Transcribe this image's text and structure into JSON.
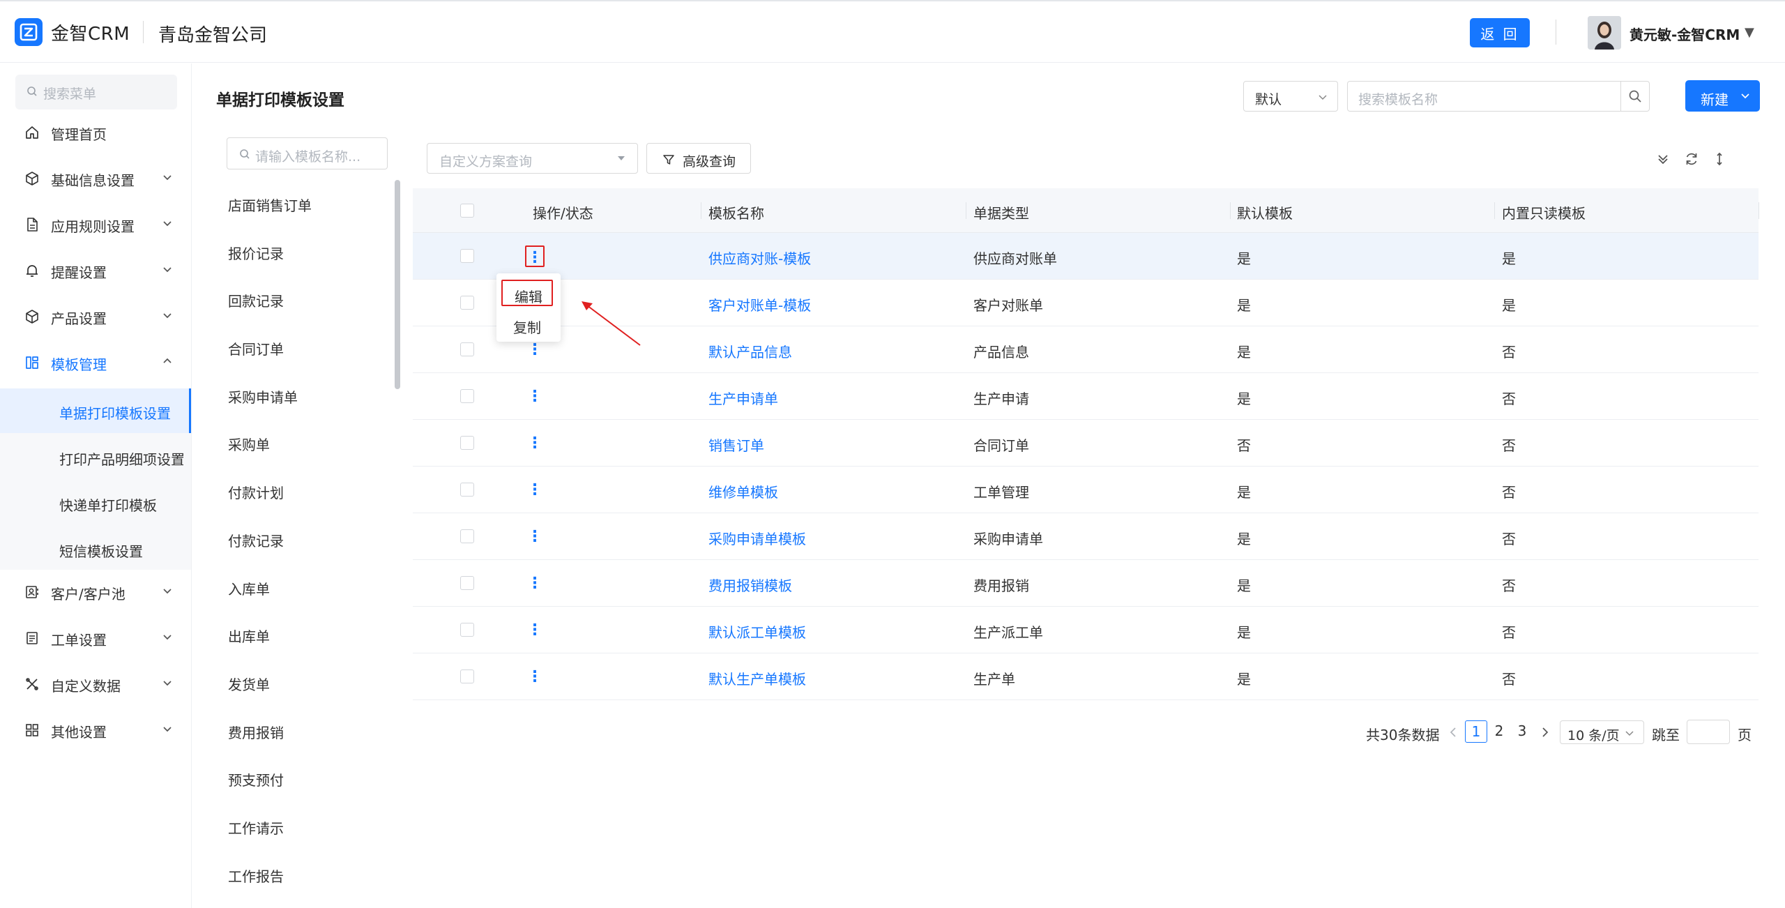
{
  "header": {
    "brand": "金智CRM",
    "company": "青岛金智公司",
    "back_label": "返 回",
    "user_name": "黄元敏-金智CRM"
  },
  "sidebar": {
    "search_placeholder": "搜索菜单",
    "items": [
      {
        "label": "管理首页",
        "icon": "home-icon",
        "arrow": ""
      },
      {
        "label": "基础信息设置",
        "icon": "cube-icon",
        "arrow": "down"
      },
      {
        "label": "应用规则设置",
        "icon": "document-icon",
        "arrow": "down"
      },
      {
        "label": "提醒设置",
        "icon": "bell-icon",
        "arrow": "down"
      },
      {
        "label": "产品设置",
        "icon": "box-icon",
        "arrow": "down"
      },
      {
        "label": "模板管理",
        "icon": "template-icon",
        "arrow": "up"
      },
      {
        "label": "客户/客户池",
        "icon": "contacts-icon",
        "arrow": "down"
      },
      {
        "label": "工单设置",
        "icon": "list-icon",
        "arrow": "down"
      },
      {
        "label": "自定义数据",
        "icon": "tools-icon",
        "arrow": "down"
      },
      {
        "label": "其他设置",
        "icon": "grid-icon",
        "arrow": "down"
      }
    ],
    "sub_items": [
      {
        "label": "单据打印模板设置",
        "active": true
      },
      {
        "label": "打印产品明细项设置",
        "active": false
      },
      {
        "label": "快递单打印模板",
        "active": false
      },
      {
        "label": "短信模板设置",
        "active": false
      }
    ]
  },
  "page": {
    "title": "单据打印模板设置",
    "default_select": "默认",
    "search_placeholder": "搜索模板名称",
    "new_label": "新建"
  },
  "type_list": {
    "search_placeholder": "请输入模板名称...",
    "items": [
      "店面销售订单",
      "报价记录",
      "回款记录",
      "合同订单",
      "采购申请单",
      "采购单",
      "付款计划",
      "付款记录",
      "入库单",
      "出库单",
      "发货单",
      "费用报销",
      "预支预付",
      "工作请示",
      "工作报告"
    ]
  },
  "filter": {
    "scheme_placeholder": "自定义方案查询",
    "advanced_label": "高级查询"
  },
  "table": {
    "columns": [
      "操作/状态",
      "模板名称",
      "单据类型",
      "默认模板",
      "内置只读模板"
    ],
    "rows": [
      {
        "name": "供应商对账-模板",
        "type": "供应商对账单",
        "default": "是",
        "readonly": "是"
      },
      {
        "name": "客户对账单-模板",
        "type": "客户对账单",
        "default": "是",
        "readonly": "是"
      },
      {
        "name": "默认产品信息",
        "type": "产品信息",
        "default": "是",
        "readonly": "否"
      },
      {
        "name": "生产申请单",
        "type": "生产申请",
        "default": "是",
        "readonly": "否"
      },
      {
        "name": "销售订单",
        "type": "合同订单",
        "default": "否",
        "readonly": "否"
      },
      {
        "name": "维修单模板",
        "type": "工单管理",
        "default": "是",
        "readonly": "否"
      },
      {
        "name": "采购申请单模板",
        "type": "采购申请单",
        "default": "是",
        "readonly": "否"
      },
      {
        "name": "费用报销模板",
        "type": "费用报销",
        "default": "是",
        "readonly": "否"
      },
      {
        "name": "默认派工单模板",
        "type": "生产派工单",
        "default": "是",
        "readonly": "否"
      },
      {
        "name": "默认生产单模板",
        "type": "生产单",
        "default": "是",
        "readonly": "否"
      }
    ],
    "kebab_glyph": "⋮"
  },
  "popup_menu": {
    "edit_label": "编辑",
    "copy_label": "复制"
  },
  "pagination": {
    "total_text": "共30条数据",
    "pages": [
      "1",
      "2",
      "3"
    ],
    "current_page": "1",
    "page_size": "10 条/页",
    "jump_label": "跳至",
    "page_suffix": "页"
  },
  "colors": {
    "primary": "#1677ff",
    "highlight_box": "#e02020"
  }
}
